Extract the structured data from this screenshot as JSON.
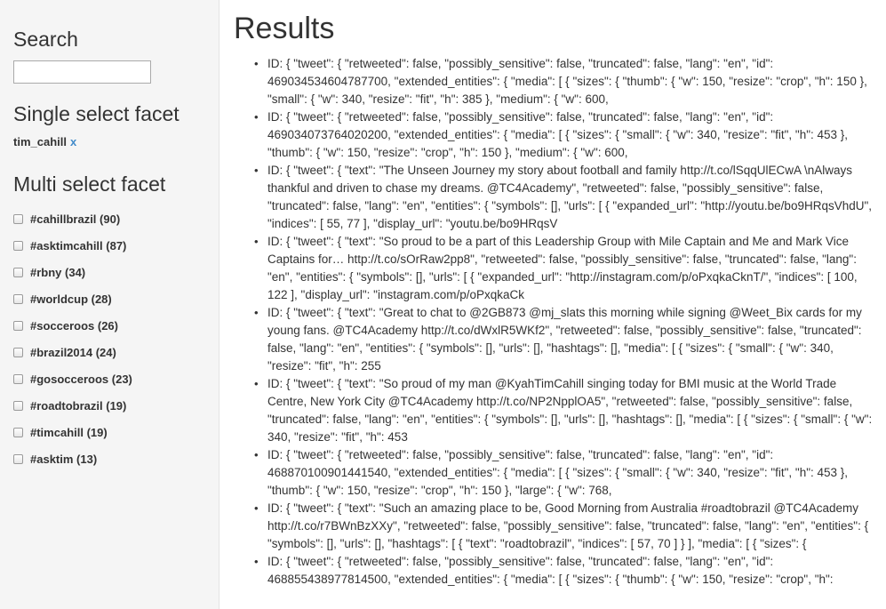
{
  "sidebar": {
    "search_title": "Search",
    "search_value": "",
    "single_title": "Single select facet",
    "single_selected": "tim_cahill",
    "single_remove": "x",
    "multi_title": "Multi select facet",
    "facets": [
      {
        "label": "#cahillbrazil (90)",
        "checked": false
      },
      {
        "label": "#asktimcahill (87)",
        "checked": false
      },
      {
        "label": "#rbny (34)",
        "checked": false
      },
      {
        "label": "#worldcup (28)",
        "checked": false
      },
      {
        "label": "#socceroos (26)",
        "checked": false
      },
      {
        "label": "#brazil2014 (24)",
        "checked": false
      },
      {
        "label": "#gosocceroos (23)",
        "checked": false
      },
      {
        "label": "#roadtobrazil (19)",
        "checked": false
      },
      {
        "label": "#timcahill (19)",
        "checked": false
      },
      {
        "label": "#asktim (13)",
        "checked": false
      }
    ]
  },
  "main": {
    "title": "Results",
    "results": [
      "ID: { \"tweet\": { \"retweeted\": false, \"possibly_sensitive\": false, \"truncated\": false, \"lang\": \"en\", \"id\": 469034534604787700, \"extended_entities\": { \"media\": [ { \"sizes\": { \"thumb\": { \"w\": 150, \"resize\": \"crop\", \"h\": 150 }, \"small\": { \"w\": 340, \"resize\": \"fit\", \"h\": 385 }, \"medium\": { \"w\": 600,",
      "ID: { \"tweet\": { \"retweeted\": false, \"possibly_sensitive\": false, \"truncated\": false, \"lang\": \"en\", \"id\": 469034073764020200, \"extended_entities\": { \"media\": [ { \"sizes\": { \"small\": { \"w\": 340, \"resize\": \"fit\", \"h\": 453 }, \"thumb\": { \"w\": 150, \"resize\": \"crop\", \"h\": 150 }, \"medium\": { \"w\": 600,",
      "ID: { \"tweet\": { \"text\": \"The Unseen Journey my story about football and family http://t.co/lSqqUlECwA \\nAlways thankful and driven to chase my dreams. @TC4Academy\", \"retweeted\": false, \"possibly_sensitive\": false, \"truncated\": false, \"lang\": \"en\", \"entities\": { \"symbols\": [], \"urls\": [ { \"expanded_url\": \"http://youtu.be/bo9HRqsVhdU\", \"indices\": [ 55, 77 ], \"display_url\": \"youtu.be/bo9HRqsV",
      "ID: { \"tweet\": { \"text\": \"So proud to be a part of this Leadership Group with Mile Captain and Me and Mark Vice Captains for… http://t.co/sOrRaw2pp8\", \"retweeted\": false, \"possibly_sensitive\": false, \"truncated\": false, \"lang\": \"en\", \"entities\": { \"symbols\": [], \"urls\": [ { \"expanded_url\": \"http://instagram.com/p/oPxqkaCknT/\", \"indices\": [ 100, 122 ], \"display_url\": \"instagram.com/p/oPxqkaCk",
      "ID: { \"tweet\": { \"text\": \"Great to chat to @2GB873 @mj_slats this morning while signing @Weet_Bix cards for my young fans. @TC4Academy http://t.co/dWxlR5WKf2\", \"retweeted\": false, \"possibly_sensitive\": false, \"truncated\": false, \"lang\": \"en\", \"entities\": { \"symbols\": [], \"urls\": [], \"hashtags\": [], \"media\": [ { \"sizes\": { \"small\": { \"w\": 340, \"resize\": \"fit\", \"h\": 255",
      "ID: { \"tweet\": { \"text\": \"So proud of my man @KyahTimCahill singing today for BMI music at the World Trade Centre, New York City @TC4Academy http://t.co/NP2NpplOA5\", \"retweeted\": false, \"possibly_sensitive\": false, \"truncated\": false, \"lang\": \"en\", \"entities\": { \"symbols\": [], \"urls\": [], \"hashtags\": [], \"media\": [ { \"sizes\": { \"small\": { \"w\": 340, \"resize\": \"fit\", \"h\": 453",
      "ID: { \"tweet\": { \"retweeted\": false, \"possibly_sensitive\": false, \"truncated\": false, \"lang\": \"en\", \"id\": 468870100901441540, \"extended_entities\": { \"media\": [ { \"sizes\": { \"small\": { \"w\": 340, \"resize\": \"fit\", \"h\": 453 }, \"thumb\": { \"w\": 150, \"resize\": \"crop\", \"h\": 150 }, \"large\": { \"w\": 768,",
      "ID: { \"tweet\": { \"text\": \"Such an amazing place to be, Good Morning from Australia #roadtobrazil @TC4Academy http://t.co/r7BWnBzXXy\", \"retweeted\": false, \"possibly_sensitive\": false, \"truncated\": false, \"lang\": \"en\", \"entities\": { \"symbols\": [], \"urls\": [], \"hashtags\": [ { \"text\": \"roadtobrazil\", \"indices\": [ 57, 70 ] } ], \"media\": [ { \"sizes\": {",
      "ID: { \"tweet\": { \"retweeted\": false, \"possibly_sensitive\": false, \"truncated\": false, \"lang\": \"en\", \"id\": 468855438977814500, \"extended_entities\": { \"media\": [ { \"sizes\": { \"thumb\": { \"w\": 150, \"resize\": \"crop\", \"h\":"
    ]
  }
}
